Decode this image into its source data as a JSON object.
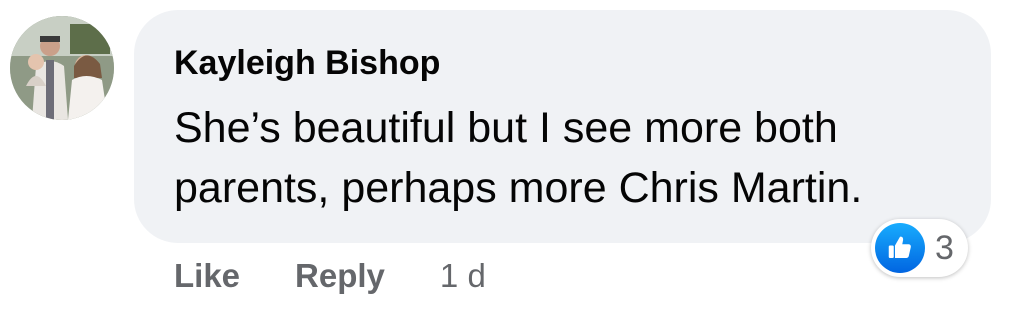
{
  "comment": {
    "author": "Kayleigh Bishop",
    "text": "She’s beautiful but I see more both parents, perhaps more Chris Martin.",
    "avatar_icon": "profile-photo",
    "reactions": {
      "icon": "thumbs-up-icon",
      "count": "3",
      "color": "#1877f2"
    }
  },
  "actions": {
    "like_label": "Like",
    "reply_label": "Reply",
    "timestamp": "1 d"
  },
  "colors": {
    "bubble_bg": "#f0f2f5",
    "text": "#050505",
    "secondary_text": "#65676b"
  }
}
